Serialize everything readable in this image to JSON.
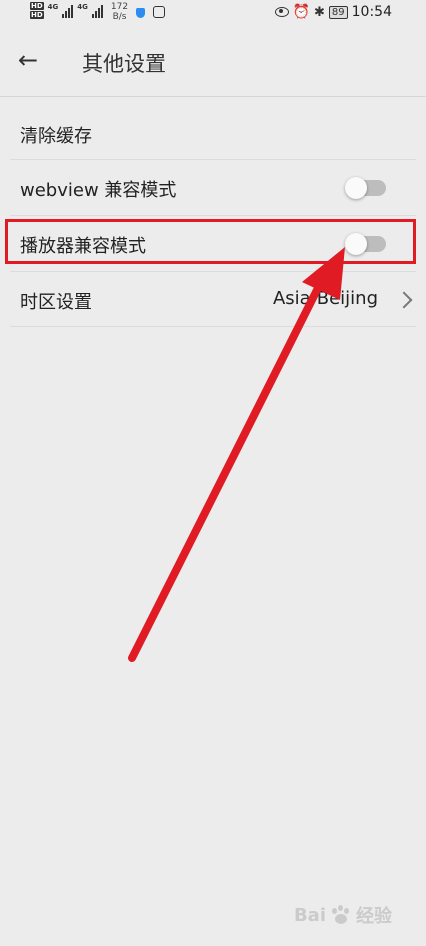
{
  "status_bar": {
    "hd_badge_1": "HD",
    "hd_badge_2": "HD",
    "network_1": "4G",
    "network_2": "4G",
    "speed_value": "172",
    "speed_unit": "B/s",
    "battery": "89",
    "time": "10:54"
  },
  "header": {
    "back_icon": "arrow-left-icon",
    "title": "其他设置"
  },
  "settings": {
    "clear_cache": {
      "label": "清除缓存"
    },
    "webview_compat": {
      "label": "webview 兼容模式",
      "enabled": false
    },
    "player_compat": {
      "label": "播放器兼容模式",
      "enabled": false
    },
    "timezone": {
      "label": "时区设置",
      "value": "Asia/Beijing"
    }
  },
  "annotation": {
    "highlight_color": "#e01b24"
  },
  "watermark": {
    "text": "Bai",
    "text_cn": "经验"
  }
}
